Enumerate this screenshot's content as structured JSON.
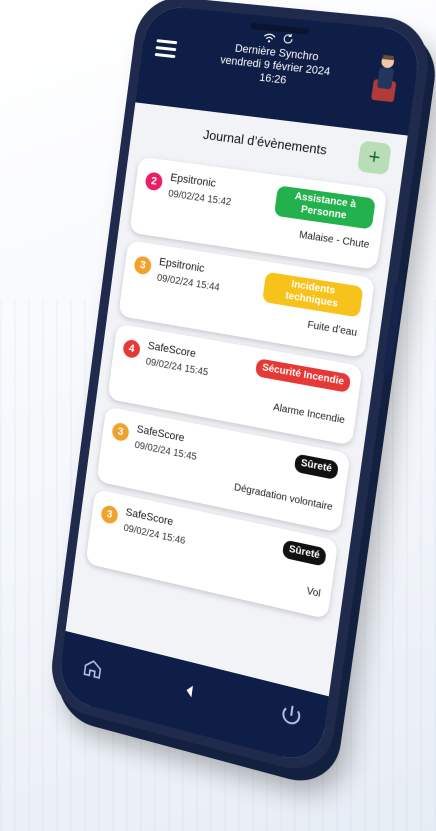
{
  "header": {
    "sync_label": "Dernière Synchro",
    "sync_date": "vendredi 9 février 2024",
    "sync_time": "16:26",
    "wifi_icon": "wifi-icon",
    "sync_icon": "sync-icon"
  },
  "journal": {
    "title": "Journal d’évènements",
    "add_label": "+"
  },
  "events": [
    {
      "priority": "2",
      "priority_color": "#e91e63",
      "source": "Epsitronic",
      "timestamp": "09/02/24 15:42",
      "category": "Assistance à Personne",
      "category_bg": "#22b14c",
      "category_fg": "#ffffff",
      "detail": "Malaise - Chute"
    },
    {
      "priority": "3",
      "priority_color": "#f2a12b",
      "source": "Epsitronic",
      "timestamp": "09/02/24 15:44",
      "category": "Incidents techniques",
      "category_bg": "#f7c21a",
      "category_fg": "#ffffff",
      "detail": "Fuite d’eau"
    },
    {
      "priority": "4",
      "priority_color": "#e53935",
      "source": "SafeScore",
      "timestamp": "09/02/24 15:45",
      "category": "Sécurité Incendie",
      "category_bg": "#e53935",
      "category_fg": "#ffffff",
      "detail": "Alarme Incendie"
    },
    {
      "priority": "3",
      "priority_color": "#f2a12b",
      "source": "SafeScore",
      "timestamp": "09/02/24 15:45",
      "category": "Sûreté",
      "category_bg": "#111111",
      "category_fg": "#ffffff",
      "detail": "Dégradation volontaire"
    },
    {
      "priority": "3",
      "priority_color": "#f2a12b",
      "source": "SafeScore",
      "timestamp": "09/02/24 15:46",
      "category": "Sûreté",
      "category_bg": "#111111",
      "category_fg": "#ffffff",
      "detail": "Vol"
    }
  ],
  "nav": {
    "home_icon": "home-icon",
    "back_icon": "back-icon",
    "power_icon": "power-icon"
  }
}
